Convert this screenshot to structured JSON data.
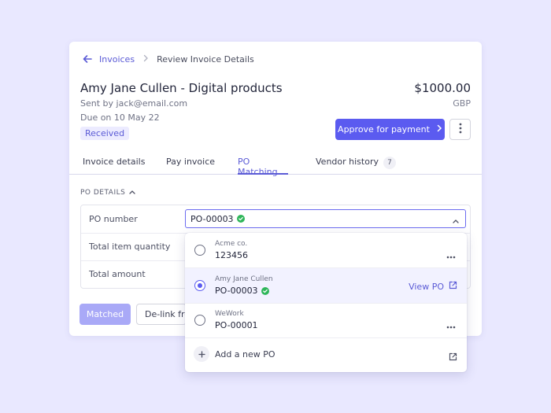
{
  "breadcrumb": {
    "parent": "Invoices",
    "current": "Review Invoice Details"
  },
  "invoice": {
    "title": "Amy Jane Cullen - Digital products",
    "amount": "$1000.00",
    "currency": "GBP",
    "sent_by": "Sent by jack@email.com",
    "due": "Due on 10 May 22",
    "status": "Received"
  },
  "actions": {
    "approve_label": "Approve for payment"
  },
  "tabs": [
    {
      "label": "Invoice details"
    },
    {
      "label": "Pay invoice"
    },
    {
      "label": "PO Matching",
      "active": true
    },
    {
      "label": "Vendor history",
      "count": "7"
    }
  ],
  "po_section": {
    "title": "PO DETAILS",
    "labels": {
      "po_number": "PO number",
      "total_qty": "Total item quantity",
      "total_amount": "Total amount"
    },
    "selected_po": "PO-00003"
  },
  "footer_buttons": {
    "matched": "Matched",
    "delink": "De-link from PO"
  },
  "dropdown": {
    "options": [
      {
        "vendor": "Acme co.",
        "po": "123456",
        "selected": false
      },
      {
        "vendor": "Amy Jane Cullen",
        "po": "PO-00003",
        "selected": true,
        "action": "View PO"
      },
      {
        "vendor": "WeWork",
        "po": "PO-00001",
        "selected": false
      }
    ],
    "add_label": "Add a new PO"
  },
  "colors": {
    "accent": "#5b5bf0",
    "background": "#e9e8ff",
    "success": "#2fb65a"
  }
}
